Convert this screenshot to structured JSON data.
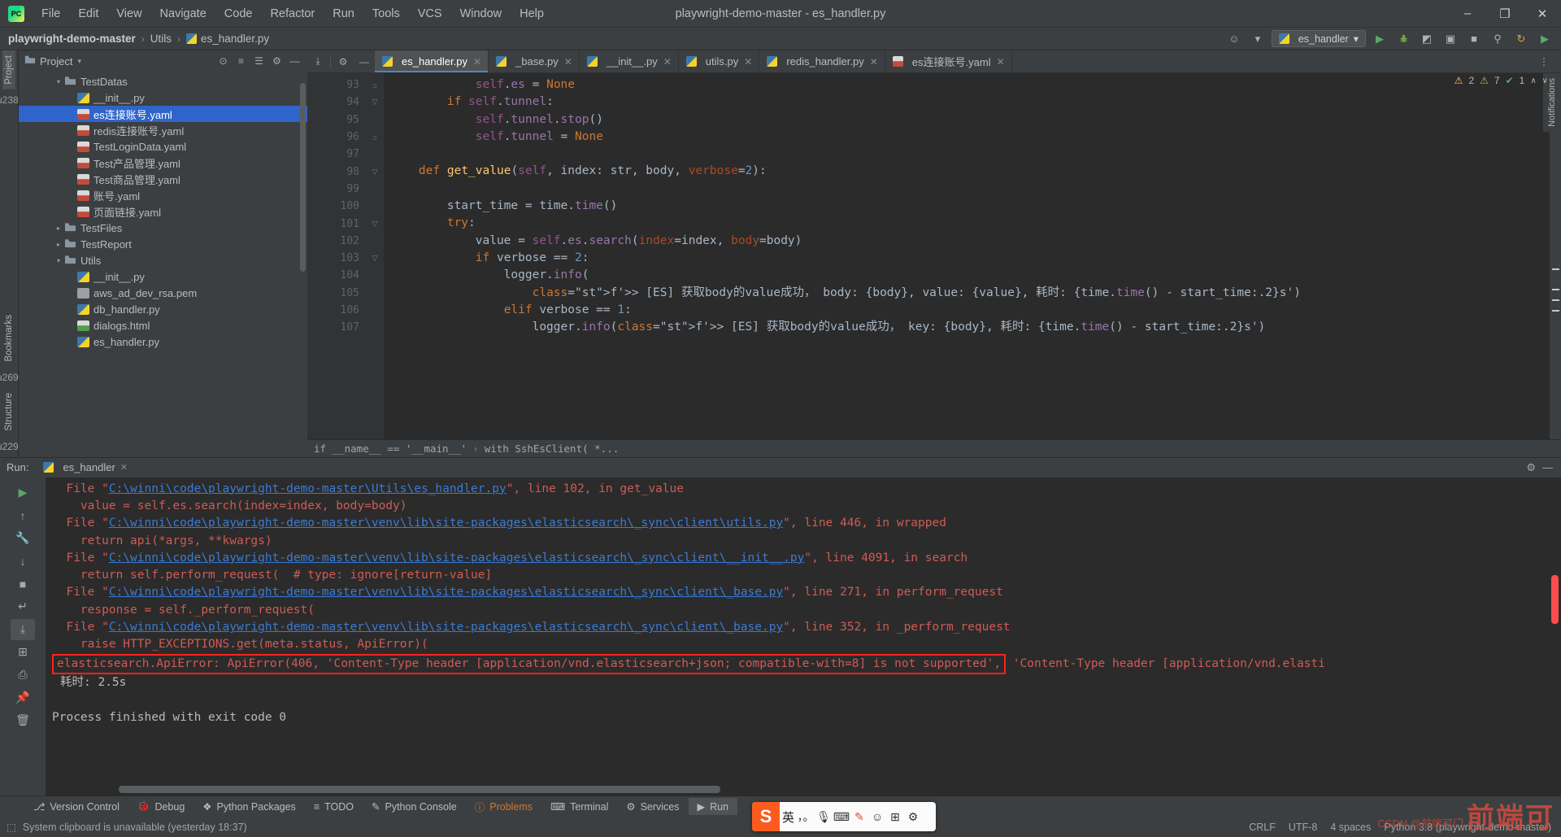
{
  "window": {
    "title": "playwright-demo-master - es_handler.py",
    "minimize": "–",
    "maximize": "❐",
    "close": "✕"
  },
  "menu": {
    "items": [
      "File",
      "Edit",
      "View",
      "Navigate",
      "Code",
      "Refactor",
      "Run",
      "Tools",
      "VCS",
      "Window",
      "Help"
    ]
  },
  "breadcrumb": {
    "project": "playwright-demo-master",
    "folder": "Utils",
    "file": "es_handler.py",
    "sep": "›"
  },
  "navbar_right": {
    "run_config": "es_handler",
    "chevron": "▾",
    "account_icon": "☺",
    "run_icon": "▶",
    "debug_icon": "ὁE",
    "coverage_icon": "◩",
    "profile_icon": "▣",
    "stop_icon": "■",
    "search_icon": "⚲",
    "update_icon": "↻",
    "plugin_icon": "▶"
  },
  "left_strip": {
    "project_tab": "Project",
    "structure_tab": "Structure",
    "bookmarks_tab": "Bookmarks"
  },
  "project_panel": {
    "title": "Project",
    "chevron": "▾",
    "actions": [
      "⊙",
      "≡",
      "☰",
      "⚙",
      "—"
    ],
    "tree": [
      {
        "indent": 2,
        "twist": "▾",
        "icon": "folder",
        "label": "TestDatas",
        "selected": false
      },
      {
        "indent": 3,
        "twist": "",
        "icon": "py",
        "label": "__init__.py",
        "selected": false
      },
      {
        "indent": 3,
        "twist": "",
        "icon": "yml",
        "label": "es连接账号.yaml",
        "selected": true
      },
      {
        "indent": 3,
        "twist": "",
        "icon": "yml",
        "label": "redis连接账号.yaml",
        "selected": false
      },
      {
        "indent": 3,
        "twist": "",
        "icon": "yml",
        "label": "TestLoginData.yaml",
        "selected": false
      },
      {
        "indent": 3,
        "twist": "",
        "icon": "yml",
        "label": "Test产品管理.yaml",
        "selected": false
      },
      {
        "indent": 3,
        "twist": "",
        "icon": "yml",
        "label": "Test商品管理.yaml",
        "selected": false
      },
      {
        "indent": 3,
        "twist": "",
        "icon": "yml",
        "label": "账号.yaml",
        "selected": false
      },
      {
        "indent": 3,
        "twist": "",
        "icon": "yml",
        "label": "页面链接.yaml",
        "selected": false
      },
      {
        "indent": 2,
        "twist": "▸",
        "icon": "folder",
        "label": "TestFiles",
        "selected": false
      },
      {
        "indent": 2,
        "twist": "▸",
        "icon": "folder",
        "label": "TestReport",
        "selected": false
      },
      {
        "indent": 2,
        "twist": "▾",
        "icon": "folder",
        "label": "Utils",
        "selected": false
      },
      {
        "indent": 3,
        "twist": "",
        "icon": "py",
        "label": "__init__.py",
        "selected": false
      },
      {
        "indent": 3,
        "twist": "",
        "icon": "pem",
        "label": "aws_ad_dev_rsa.pem",
        "selected": false
      },
      {
        "indent": 3,
        "twist": "",
        "icon": "py",
        "label": "db_handler.py",
        "selected": false
      },
      {
        "indent": 3,
        "twist": "",
        "icon": "html",
        "label": "dialogs.html",
        "selected": false
      },
      {
        "indent": 3,
        "twist": "",
        "icon": "py",
        "label": "es_handler.py",
        "selected": false
      }
    ]
  },
  "editor": {
    "toolbar_icons": [
      "⤓",
      "⚙",
      "—"
    ],
    "tabs": [
      {
        "label": "es_handler.py",
        "icon": "py",
        "active": true,
        "close": "✕"
      },
      {
        "label": "_base.py",
        "icon": "py",
        "active": false,
        "close": "✕"
      },
      {
        "label": "__init__.py",
        "icon": "py",
        "active": false,
        "close": "✕"
      },
      {
        "label": "utils.py",
        "icon": "py",
        "active": false,
        "close": "✕"
      },
      {
        "label": "redis_handler.py",
        "icon": "py",
        "active": false,
        "close": "✕"
      },
      {
        "label": "es连接账号.yaml",
        "icon": "yml",
        "active": false,
        "close": "✕"
      }
    ],
    "more_icon": "⋮",
    "inspections": {
      "warning_icon": "⚠",
      "warning_count": "2",
      "weak_icon": "⚠",
      "weak_count": "7",
      "ok_icon": "✔",
      "ok_count": "1",
      "chevron_up": "∧",
      "chevron_down": "∨"
    },
    "line_numbers": [
      "93",
      "94",
      "95",
      "96",
      "97",
      "98",
      "99",
      "100",
      "101",
      "102",
      "103",
      "104",
      "105",
      "106",
      "107"
    ],
    "code_lines": [
      "            self.es = None",
      "        if self.tunnel:",
      "            self.tunnel.stop()",
      "            self.tunnel = None",
      "",
      "    def get_value(self, index: str, body, verbose=2):",
      "",
      "        start_time = time.time()",
      "        try:",
      "            value = self.es.search(index=index, body=body)",
      "            if verbose == 2:",
      "                logger.info(",
      "                    f'>> [ES] 获取body的value成功， body: {body}, value: {value}, 耗时: {time.time() - start_time:.2}s')",
      "                elif verbose == 1:",
      "                    logger.info(f'>> [ES] 获取body的value成功， key: {body}, 耗时: {time.time() - start_time:.2}s')"
    ],
    "breadcrumb_bar": {
      "scope": "if __name__ == '__main__'",
      "sep": "›",
      "context": "with SshEsClient(       *..."
    }
  },
  "run_panel": {
    "label": "Run:",
    "tab_name": "es_handler",
    "tab_close": "✕",
    "settings_icon": "⚙",
    "minimize_icon": "—",
    "tools": [
      "▶",
      "↑",
      "🔧",
      "↓",
      "■",
      "↵",
      "⤓",
      "⊞",
      "⎙",
      "📌",
      "🗑"
    ],
    "console_lines": [
      {
        "type": "trace",
        "prefix": "  File \"",
        "link": "C:\\winni\\code\\playwright-demo-master\\Utils\\es_handler.py",
        "suffix": "\", line 102, in get_value"
      },
      {
        "type": "code",
        "text": "    value = self.es.search(index=index, body=body)"
      },
      {
        "type": "trace",
        "prefix": "  File \"",
        "link": "C:\\winni\\code\\playwright-demo-master\\venv\\lib\\site-packages\\elasticsearch\\_sync\\client\\utils.py",
        "suffix": "\", line 446, in wrapped"
      },
      {
        "type": "code",
        "text": "    return api(*args, **kwargs)"
      },
      {
        "type": "trace",
        "prefix": "  File \"",
        "link": "C:\\winni\\code\\playwright-demo-master\\venv\\lib\\site-packages\\elasticsearch\\_sync\\client\\__init__.py",
        "suffix": "\", line 4091, in search"
      },
      {
        "type": "code",
        "text": "    return self.perform_request(  # type: ignore[return-value]"
      },
      {
        "type": "trace",
        "prefix": "  File \"",
        "link": "C:\\winni\\code\\playwright-demo-master\\venv\\lib\\site-packages\\elasticsearch\\_sync\\client\\_base.py",
        "suffix": "\", line 271, in perform_request"
      },
      {
        "type": "code",
        "text": "    response = self._perform_request("
      },
      {
        "type": "trace",
        "prefix": "  File \"",
        "link": "C:\\winni\\code\\playwright-demo-master\\venv\\lib\\site-packages\\elasticsearch\\_sync\\client\\_base.py",
        "suffix": "\", line 352, in _perform_request"
      },
      {
        "type": "code",
        "text": "    raise HTTP_EXCEPTIONS.get(meta.status, ApiError)("
      }
    ],
    "error_boxed": "elasticsearch.ApiError: ApiError(406, 'Content-Type header [application/vnd.elasticsearch+json; compatible-with=8] is not supported',",
    "error_overflow": " 'Content-Type header [application/vnd.elasti",
    "elapsed": "耗时: 2.5s",
    "finished": "Process finished with exit code 0"
  },
  "tool_window_bar": {
    "items": [
      {
        "label": "Version Control",
        "icon": "⎇",
        "selected": false
      },
      {
        "label": "Debug",
        "icon": "🐞",
        "selected": false
      },
      {
        "label": "Python Packages",
        "icon": "❖",
        "selected": false
      },
      {
        "label": "TODO",
        "icon": "≡",
        "selected": false
      },
      {
        "label": "Python Console",
        "icon": "✎",
        "selected": false
      },
      {
        "label": "Problems",
        "icon": "ⓘ",
        "selected": false
      },
      {
        "label": "Terminal",
        "icon": "⌨",
        "selected": false
      },
      {
        "label": "Services",
        "icon": "⚙",
        "selected": false
      },
      {
        "label": "Run",
        "icon": "▶",
        "selected": true
      }
    ]
  },
  "status_bar": {
    "icon": "⬚",
    "message": "System clipboard is unavailable (yesterday 18:37)",
    "line_sep": "CRLF",
    "encoding": "UTF-8",
    "indent": "4 spaces",
    "interpreter": "Python 3.8 (playwright-demo-master)"
  },
  "ime_bar": {
    "logo": "S",
    "mode": "英",
    "punct": "，。",
    "mic": "🎙",
    "keyboard": "⌨",
    "pen": "✎",
    "emoji": "☺",
    "grid": "⊞",
    "more": "⚙"
  },
  "watermark": {
    "text": "前端可",
    "sub": "CSDN @前端可门"
  }
}
